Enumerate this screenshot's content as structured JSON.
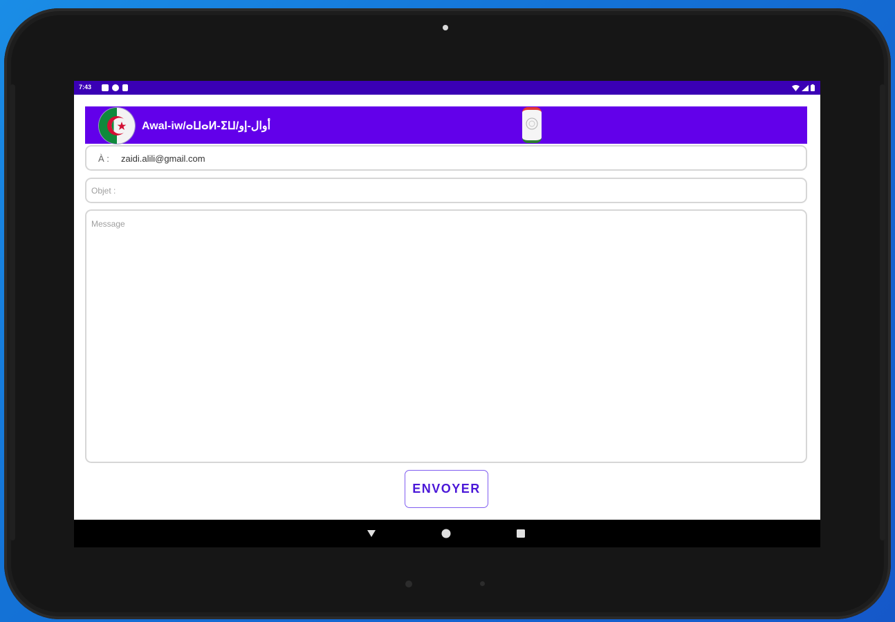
{
  "status_bar": {
    "time": "7:43"
  },
  "app_bar": {
    "title": "Awal-iw/ⴰⵡⴰⵍ-ⵉⵡ/أوال-إو"
  },
  "form": {
    "to_label": "À :",
    "to_value": "zaidi.alili@gmail.com",
    "subject_placeholder": "Objet :",
    "message_placeholder": "Message",
    "send_label": "ENVOYER"
  },
  "colors": {
    "status_bar": "#3a00b5",
    "app_bar": "#6200ea",
    "button_text": "#4b18d8"
  },
  "icons": {
    "status_left": [
      "notification-icon",
      "sync-icon",
      "sd-card-icon"
    ],
    "status_right": [
      "wifi-icon",
      "signal-icon",
      "battery-icon"
    ],
    "nav": [
      "back-icon",
      "home-icon",
      "recents-icon"
    ]
  }
}
